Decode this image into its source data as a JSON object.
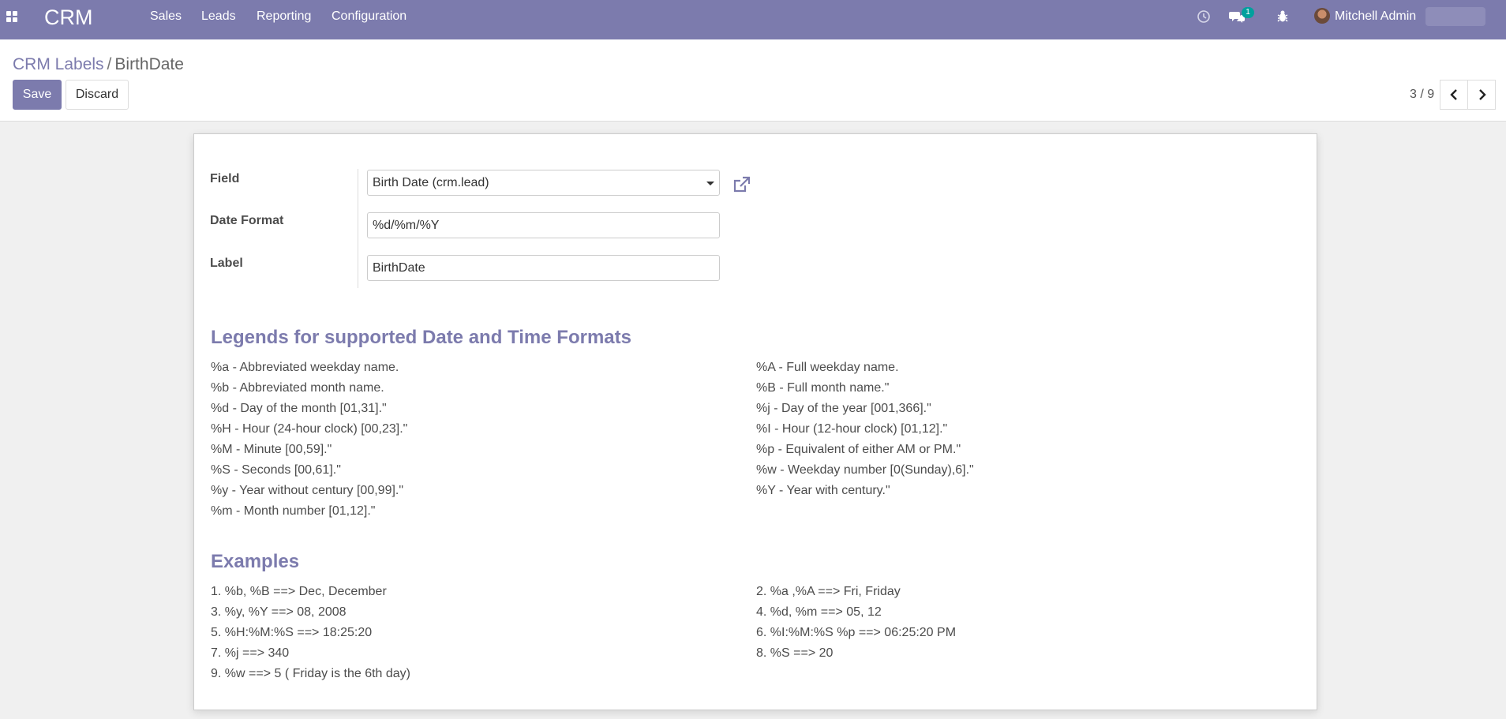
{
  "navbar": {
    "brand": "CRM",
    "menu": [
      "Sales",
      "Leads",
      "Reporting",
      "Configuration"
    ],
    "messages_badge": "1",
    "user_name": "Mitchell Admin"
  },
  "breadcrumb": {
    "parent": "CRM Labels",
    "separator": "/",
    "current": "BirthDate"
  },
  "buttons": {
    "save": "Save",
    "discard": "Discard"
  },
  "pager": {
    "value": "3 / 9"
  },
  "form": {
    "field_label": "Field",
    "field_value": "Birth Date (crm.lead)",
    "date_format_label": "Date Format",
    "date_format_value": "%d/%m/%Y",
    "label_label": "Label",
    "label_value": "BirthDate"
  },
  "legends": {
    "title": "Legends for supported Date and Time Formats",
    "left": [
      "%a - Abbreviated weekday name.",
      "%b - Abbreviated month name.",
      "%d - Day of the month [01,31].\"",
      "%H - Hour (24-hour clock) [00,23].\"",
      "%M - Minute [00,59].\"",
      "%S - Seconds [00,61].\"",
      "%y - Year without century [00,99].\"",
      "%m - Month number [01,12].\""
    ],
    "right": [
      "%A - Full weekday name.",
      "%B - Full month name.\"",
      "%j - Day of the year [001,366].\"",
      "%I - Hour (12-hour clock) [01,12].\"",
      "%p - Equivalent of either AM or PM.\"",
      "%w - Weekday number [0(Sunday),6].\"",
      "%Y - Year with century.\""
    ]
  },
  "examples": {
    "title": "Examples",
    "left": [
      "1. %b, %B ==> Dec, December",
      "3. %y, %Y ==> 08, 2008",
      "5. %H:%M:%S ==> 18:25:20",
      "7. %j ==> 340",
      "9. %w ==> 5 ( Friday is the 6th day)"
    ],
    "right": [
      "2. %a ,%A ==> Fri, Friday",
      "4. %d, %m ==> 05, 12",
      "6. %I:%M:%S %p ==> 06:25:20 PM",
      "8. %S ==> 20"
    ]
  },
  "colors": {
    "brand": "#7c7bad",
    "badge": "#00a09d"
  },
  "icons": [
    "apps-icon",
    "clock-icon",
    "chat-icon",
    "bug-icon",
    "external-link-icon",
    "chevron-left-icon",
    "chevron-right-icon"
  ]
}
